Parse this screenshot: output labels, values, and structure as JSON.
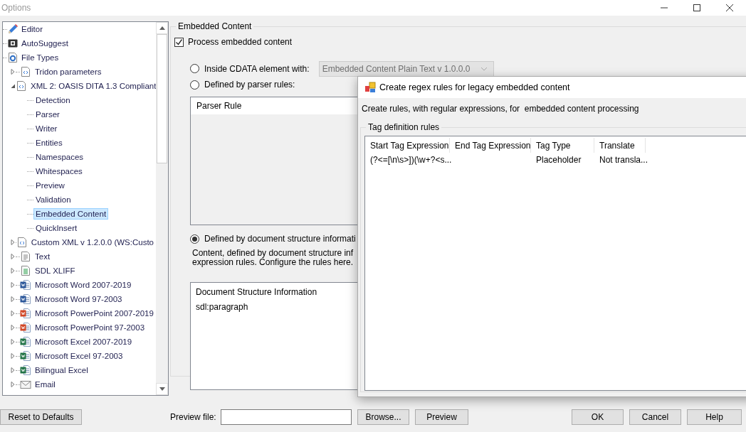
{
  "window": {
    "title": "Options"
  },
  "tree": {
    "items": [
      {
        "label": "Editor",
        "kind": "pencil",
        "selected": false
      },
      {
        "label": "AutoSuggest",
        "kind": "suggest",
        "selected": false
      },
      {
        "label": "File Types",
        "kind": "settings",
        "selected": false,
        "children": [
          {
            "label": "Tridon parameters",
            "kind": "code",
            "expanded": false,
            "selected": false
          },
          {
            "label": "XML 2: OASIS DITA 1.3 Compliant",
            "kind": "code",
            "expanded": true,
            "selected": false,
            "children": [
              {
                "label": "Detection",
                "selected": false
              },
              {
                "label": "Parser",
                "selected": false
              },
              {
                "label": "Writer",
                "selected": false
              },
              {
                "label": "Entities",
                "selected": false
              },
              {
                "label": "Namespaces",
                "selected": false
              },
              {
                "label": "Whitespaces",
                "selected": false
              },
              {
                "label": "Preview",
                "selected": false
              },
              {
                "label": "Validation",
                "selected": false
              },
              {
                "label": "Embedded Content",
                "selected": true
              },
              {
                "label": "QuickInsert",
                "selected": false
              }
            ]
          },
          {
            "label": "Custom XML v 1.2.0.0 (WS:Custo",
            "kind": "code",
            "expanded": false,
            "selected": false
          },
          {
            "label": "Text",
            "kind": "text",
            "expanded": false,
            "selected": false
          },
          {
            "label": "SDL XLIFF",
            "kind": "list",
            "expanded": false,
            "selected": false
          },
          {
            "label": "Microsoft Word 2007-2019",
            "kind": "word",
            "expanded": false,
            "selected": false
          },
          {
            "label": "Microsoft Word 97-2003",
            "kind": "word-old",
            "expanded": false,
            "selected": false
          },
          {
            "label": "Microsoft PowerPoint 2007-2019",
            "kind": "slides",
            "expanded": false,
            "selected": false
          },
          {
            "label": "Microsoft PowerPoint 97-2003",
            "kind": "slides-old",
            "expanded": false,
            "selected": false
          },
          {
            "label": "Microsoft Excel 2007-2019",
            "kind": "sheet",
            "expanded": false,
            "selected": false
          },
          {
            "label": "Microsoft Excel 97-2003",
            "kind": "sheet-old",
            "expanded": false,
            "selected": false
          },
          {
            "label": "Bilingual Excel",
            "kind": "bilingual",
            "expanded": false,
            "selected": false
          },
          {
            "label": "Email",
            "kind": "email",
            "expanded": false,
            "selected": false
          }
        ]
      }
    ]
  },
  "embedded_content": {
    "title": "Embedded Content",
    "process": {
      "label": "Process embedded content",
      "checked": true
    },
    "options": [
      {
        "label": "Inside CDATA element with:",
        "selected": false
      },
      {
        "label": "Defined by parser rules:",
        "selected": false
      },
      {
        "label": "Defined by document structure informati",
        "selected": true
      }
    ],
    "cdata_dropdown": {
      "value": "Embedded Content Plain Text v 1.0.0.0",
      "disabled": true
    },
    "parser_rules": {
      "columns": [
        "Parser Rule"
      ]
    },
    "description": [
      "Content, defined by document structure inf",
      "expression rules. Configure the rules here."
    ],
    "structure": {
      "columns": [
        "Document Structure Information"
      ],
      "rows": [
        "sdl:paragraph"
      ]
    }
  },
  "dialog": {
    "title": "Create regex rules for legacy embedded content",
    "description": "Create rules, with regular expressions, for  embedded content processing",
    "group": "Tag definition rules",
    "columns": [
      "Start Tag Expression",
      "End Tag Expression",
      "Tag Type",
      "Translate"
    ],
    "rows": [
      {
        "start_tag": "(?<=[\\n\\s>])(\\w+?<s...",
        "tag_type": "Placeholder",
        "translate": "Not transla..."
      }
    ]
  },
  "footer": {
    "reset": "Reset to Defaults",
    "preview_label": "Preview file:",
    "browse": "Browse...",
    "preview": "Preview",
    "buttons": [
      "OK",
      "Cancel",
      "Help"
    ]
  }
}
